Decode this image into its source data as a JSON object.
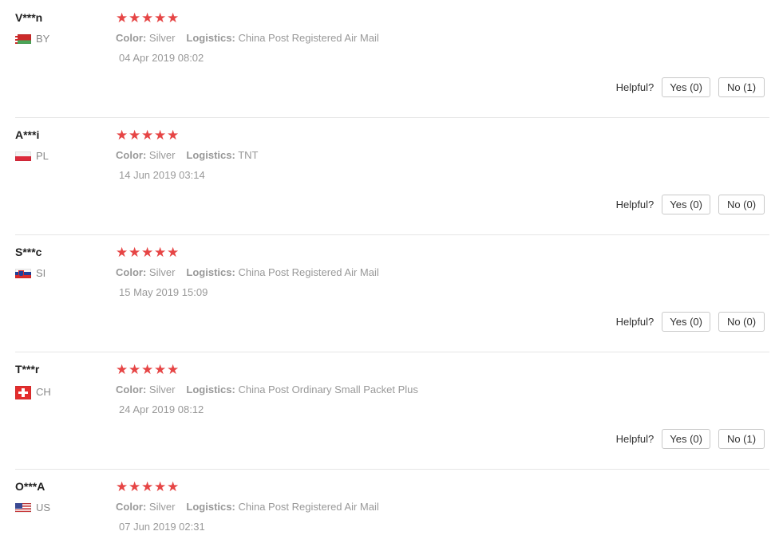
{
  "helpful_label": "Helpful?",
  "color_label": "Color:",
  "logistics_label": "Logistics:",
  "star_glyph": "★",
  "star_color": "#e64545",
  "reviews": [
    {
      "user": "V***n",
      "country": "BY",
      "flag": "belarus-flag-icon",
      "rating": 5,
      "color": "Silver",
      "logistics": "China Post Registered Air Mail",
      "date": "04 Apr 2019 08:02",
      "yes": "Yes (0)",
      "no": "No (1)"
    },
    {
      "user": "A***i",
      "country": "PL",
      "flag": "poland-flag-icon",
      "rating": 5,
      "color": "Silver",
      "logistics": "TNT",
      "date": "14 Jun 2019 03:14",
      "yes": "Yes (0)",
      "no": "No (0)"
    },
    {
      "user": "S***c",
      "country": "SI",
      "flag": "slovenia-flag-icon",
      "rating": 5,
      "color": "Silver",
      "logistics": "China Post Registered Air Mail",
      "date": "15 May 2019 15:09",
      "yes": "Yes (0)",
      "no": "No (0)"
    },
    {
      "user": "T***r",
      "country": "CH",
      "flag": "switzerland-flag-icon",
      "rating": 5,
      "color": "Silver",
      "logistics": "China Post Ordinary Small Packet Plus",
      "date": "24 Apr 2019 08:12",
      "yes": "Yes (0)",
      "no": "No (1)"
    },
    {
      "user": "O***A",
      "country": "US",
      "flag": "usa-flag-icon",
      "rating": 5,
      "color": "Silver",
      "logistics": "China Post Registered Air Mail",
      "date": "07 Jun 2019 02:31"
    }
  ]
}
